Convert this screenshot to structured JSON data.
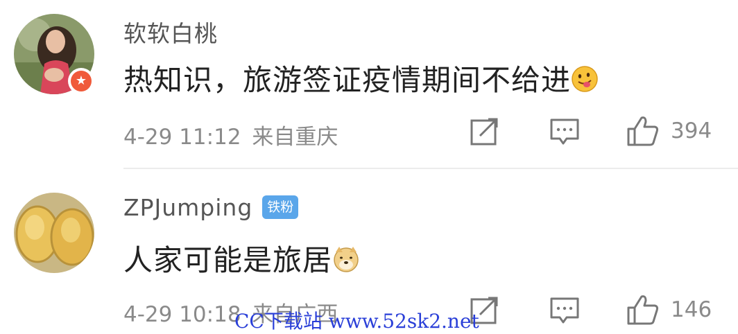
{
  "comments": [
    {
      "username": "软软白桃",
      "text": "热知识，旅游签证疫情期间不给进",
      "emoji": "tongue-face-emoji",
      "time": "4-29 11:12",
      "location": "来自重庆",
      "likes": "394",
      "avatar_badge": "v-badge",
      "user_badge": ""
    },
    {
      "username": "ZPJumping",
      "text": "人家可能是旅居",
      "emoji": "doge-emoji",
      "time": "4-29 10:18",
      "location": "来自广西",
      "likes": "146",
      "user_badge": "铁粉"
    }
  ],
  "avatar_badge_glyph": "★",
  "watermark": "CC下载站 www.52sk2.net",
  "colors": {
    "text_primary": "#222222",
    "text_secondary": "#8a8a8a",
    "badge_blue": "#5aa6ea",
    "badge_orange": "#f05a3a",
    "watermark": "#2a3fd8"
  }
}
